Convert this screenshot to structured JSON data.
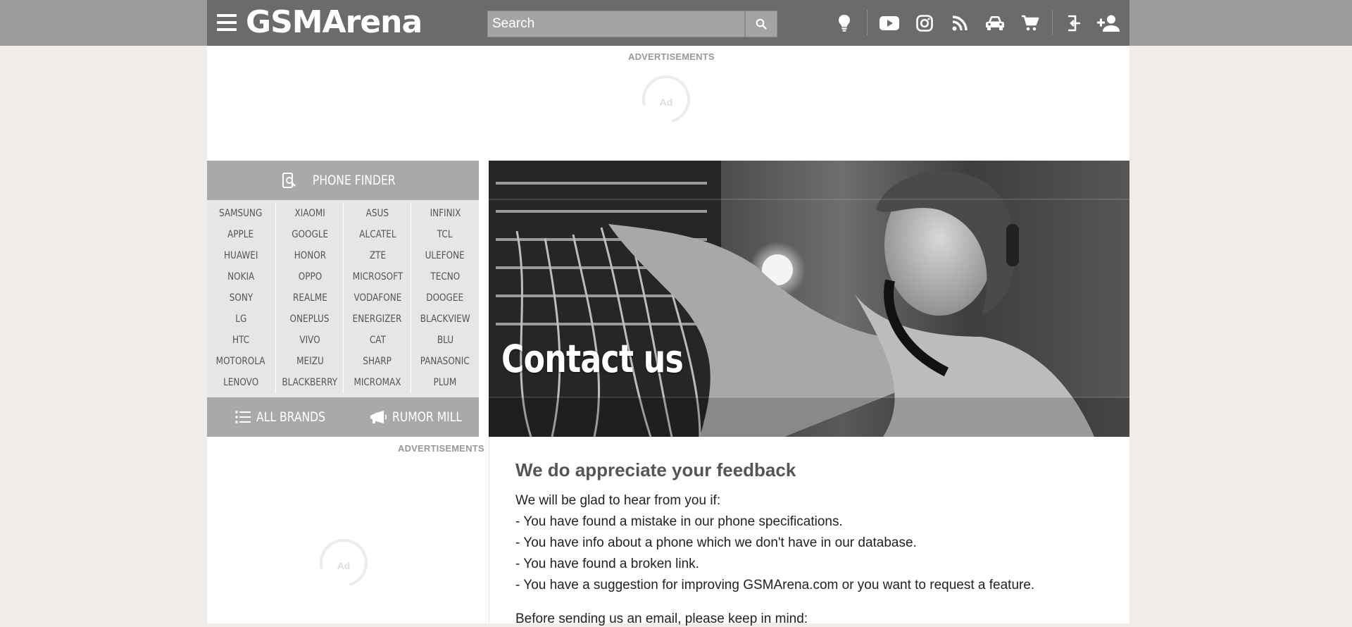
{
  "header": {
    "logo": "GSMArena",
    "search_placeholder": "Search",
    "icons": [
      "menu-icon",
      "search-icon",
      "lightbulb-icon",
      "youtube-icon",
      "instagram-icon",
      "rss-icon",
      "car-icon",
      "cart-icon",
      "login-icon",
      "signup-icon"
    ]
  },
  "ads": {
    "top_label": "ADVERTISEMENTS",
    "side_label": "ADVERTISEMENTS",
    "spinner_text": "Ad"
  },
  "brandmenu": {
    "phone_finder_label": "PHONE FINDER",
    "columns": [
      [
        "SAMSUNG",
        "APPLE",
        "HUAWEI",
        "NOKIA",
        "SONY",
        "LG",
        "HTC",
        "MOTOROLA",
        "LENOVO"
      ],
      [
        "XIAOMI",
        "GOOGLE",
        "HONOR",
        "OPPO",
        "REALME",
        "ONEPLUS",
        "VIVO",
        "MEIZU",
        "BLACKBERRY"
      ],
      [
        "ASUS",
        "ALCATEL",
        "ZTE",
        "MICROSOFT",
        "VODAFONE",
        "ENERGIZER",
        "CAT",
        "SHARP",
        "MICROMAX"
      ],
      [
        "INFINIX",
        "TCL",
        "ULEFONE",
        "TECNO",
        "DOOGEE",
        "BLACKVIEW",
        "BLU",
        "PANASONIC",
        "PLUM"
      ]
    ],
    "all_brands_label": "ALL BRANDS",
    "rumor_mill_label": "RUMOR MILL"
  },
  "hero": {
    "title": "Contact us"
  },
  "article": {
    "heading": "We do appreciate your feedback",
    "lines": [
      "We will be glad to hear from you if:",
      "- You have found a mistake in our phone specifications.",
      "- You have info about a phone which we don't have in our database.",
      "- You have found a broken link.",
      "- You have a suggestion for improving GSMArena.com or you want to request a feature."
    ],
    "more": "Before sending us an email, please keep in mind:"
  },
  "colors": {
    "page_bg": "#efecea",
    "header_bg": "#6b6b6b",
    "topbar_bg": "#9c9c9c",
    "brandmenu_bg": "#e6e6e6",
    "brandmenu_head_bg": "#a9a9a9"
  }
}
